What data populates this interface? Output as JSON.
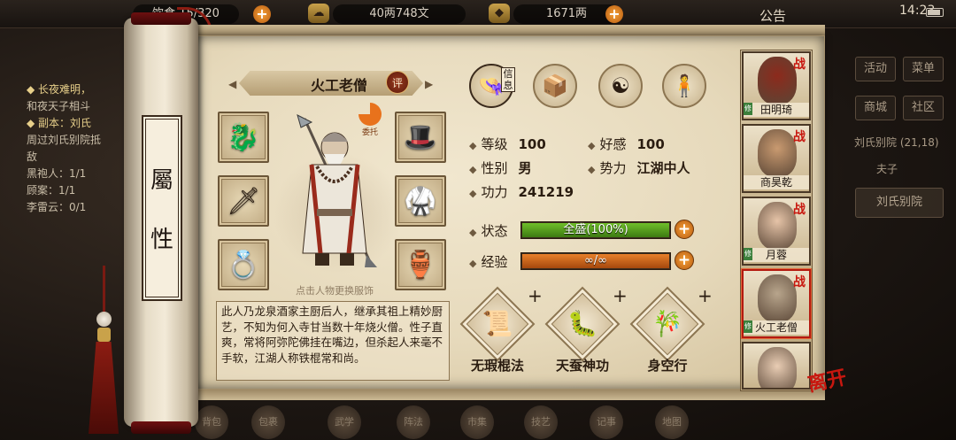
{
  "topbar": {
    "backpack_count": "15/320",
    "backpack_prefix": "饮食",
    "silver": "40两748文",
    "gold": "1671两",
    "notice": "公告",
    "time": "14:23"
  },
  "quest_panel": {
    "lines": [
      "◆ 长夜难明，",
      "和夜天子相斗",
      "◆ 副本：刘氏",
      "周过刘氏别院抵",
      "敌",
      "黑袍人：1/1",
      "顾案：1/1",
      "李雷云：0/1"
    ]
  },
  "right_menu": {
    "buttons": [
      "活动",
      "菜单",
      "商城",
      "社区"
    ],
    "location": "刘氏别院 (21,18)",
    "location_tag": "夫子",
    "location_button": "刘氏别院"
  },
  "bottom_nav": [
    "背包",
    "包裹",
    "武学",
    "阵法",
    "市集",
    "技艺",
    "记事",
    "地图"
  ],
  "scroll": {
    "title_top": "屬",
    "title_bottom": "性"
  },
  "character": {
    "name": "火工老僧",
    "review_label": "评",
    "entrust_label": "委托",
    "hint": "点击人物更换服饰",
    "description": "此人乃龙泉酒家主厨后人，继承其祖上精妙厨艺，不知为何入寺甘当数十年烧火僧。性子直爽，常将阿弥陀佛挂在嘴边，但杀起人来毫不手软，江湖人称铁棍常和尚。"
  },
  "equipment": [
    {
      "name": "weapon-slot",
      "icon": "🐉"
    },
    {
      "name": "hidden-weapon-slot",
      "icon": "🗡"
    },
    {
      "name": "ring-slot",
      "icon": "💍"
    },
    {
      "name": "headgear-slot",
      "icon": "🎩"
    },
    {
      "name": "armor-slot",
      "icon": "🥋"
    },
    {
      "name": "accessory-slot",
      "icon": "🏺"
    }
  ],
  "tabs": [
    {
      "label": "信息",
      "icon": "hat-icon",
      "glyph": "👒",
      "active": true
    },
    {
      "label": "",
      "icon": "book-icon",
      "glyph": "📦",
      "active": false
    },
    {
      "label": "",
      "icon": "bagua-icon",
      "glyph": "☯",
      "active": false
    },
    {
      "label": "",
      "icon": "meridian-icon",
      "glyph": "🧍",
      "active": false
    }
  ],
  "stats": {
    "level_label": "等级",
    "level": "100",
    "favor_label": "好感",
    "favor": "100",
    "gender_label": "性别",
    "gender": "男",
    "faction_label": "势力",
    "faction": "江湖中人",
    "power_label": "功力",
    "power": "241219"
  },
  "status_bar": {
    "label": "状态",
    "text": "全盛(100%)",
    "percent": 100,
    "color": "#6fbf2a"
  },
  "exp_bar": {
    "label": "经验",
    "text": "∞/∞",
    "percent": 100,
    "color": "#e8802a"
  },
  "skills": [
    {
      "name": "无瑕棍法",
      "icon": "scroll-icon",
      "glyph": "📜"
    },
    {
      "name": "天蚕神功",
      "icon": "silkworm-icon",
      "glyph": "🐛"
    },
    {
      "name": "身空行",
      "icon": "jade-scroll-icon",
      "glyph": "🎋"
    }
  ],
  "party": [
    {
      "name": "田明琦",
      "tag": "战",
      "mod": "修",
      "face": "#8c2a1c"
    },
    {
      "name": "商昊乾",
      "tag": "战",
      "mod": "",
      "face": "#c99a70"
    },
    {
      "name": "月蓉",
      "tag": "战",
      "mod": "修",
      "face": "#e6c4a8"
    },
    {
      "name": "火工老僧",
      "tag": "战",
      "mod": "修",
      "face": "#b8a58c"
    },
    {
      "name": "",
      "tag": "",
      "mod": "",
      "face": "#e9cdb4"
    }
  ],
  "leave_label": "离开",
  "colors": {
    "accent": "#b41a10",
    "paper": "#e6d9bb",
    "orange": "#e8802a",
    "green": "#6fbf2a"
  }
}
